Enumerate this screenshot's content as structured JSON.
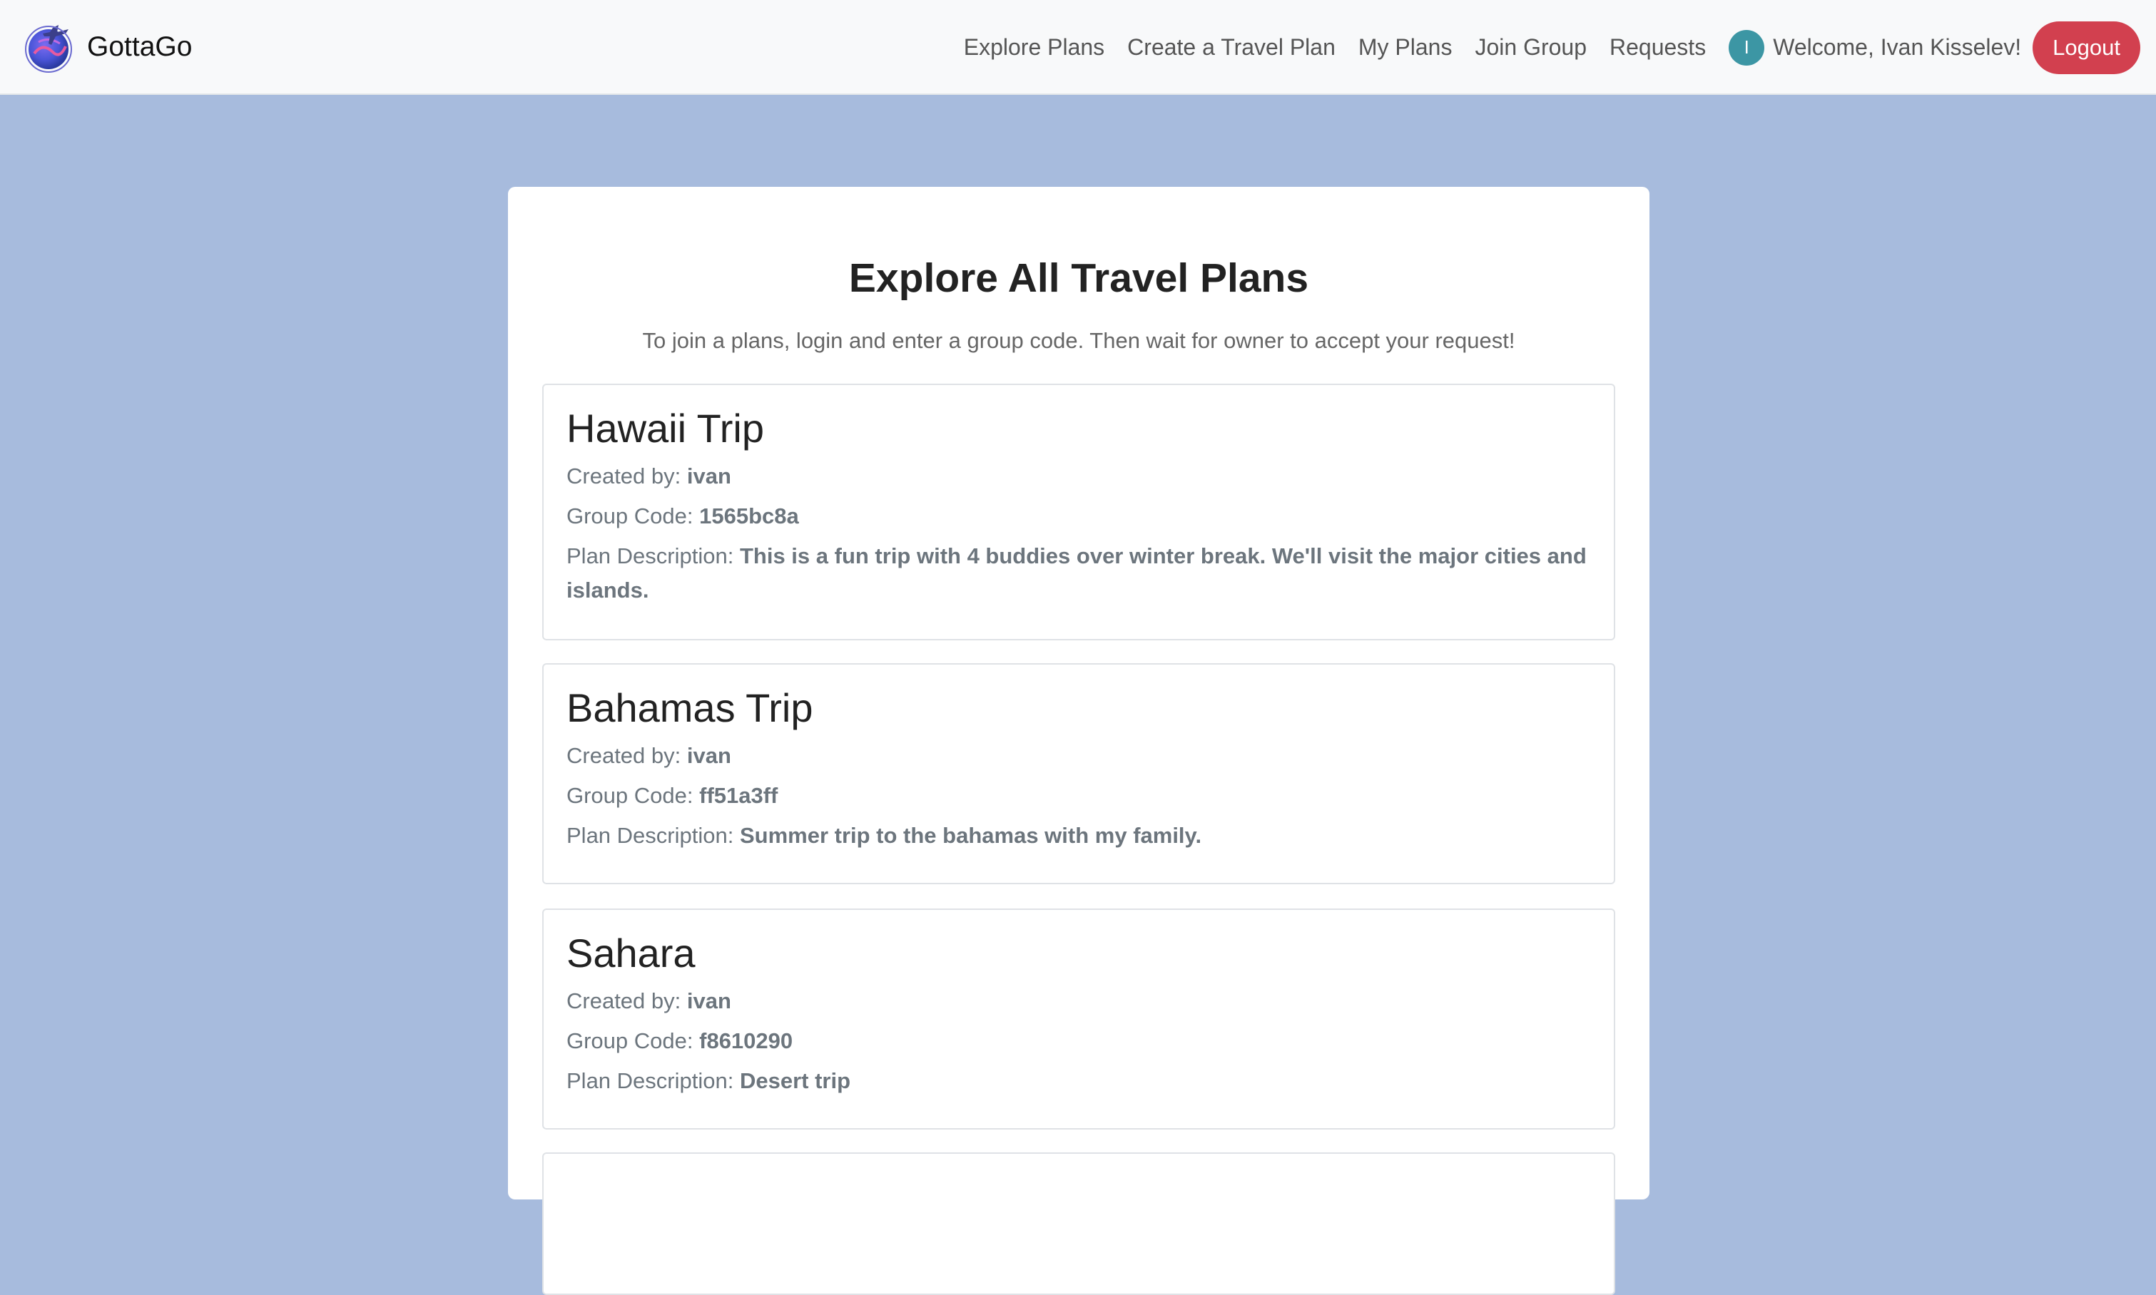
{
  "brand": {
    "name": "GottaGo"
  },
  "nav": {
    "links": [
      "Explore Plans",
      "Create a Travel Plan",
      "My Plans",
      "Join Group",
      "Requests"
    ],
    "avatar_initial": "I",
    "welcome": "Welcome, Ivan Kisselev!",
    "logout": "Logout"
  },
  "page": {
    "title": "Explore All Travel Plans",
    "subtitle": "To join a plans, login and enter a group code. Then wait for owner to accept your request!"
  },
  "labels": {
    "created_by": "Created by:",
    "group_code": "Group Code:",
    "plan_description": "Plan Description:"
  },
  "plans": [
    {
      "title": "Hawaii Trip",
      "creator": "ivan",
      "code": "1565bc8a",
      "description": "This is a fun trip with 4 buddies over winter break. We'll visit the major cities and islands."
    },
    {
      "title": "Bahamas Trip",
      "creator": "ivan",
      "code": "ff51a3ff",
      "description": "Summer trip to the bahamas with my family."
    },
    {
      "title": "Sahara",
      "creator": "ivan",
      "code": "f8610290",
      "description": "Desert trip"
    }
  ],
  "colors": {
    "background": "#a7bbdd",
    "navbar": "#f8f9fa",
    "logout": "#d2404f",
    "avatar": "#3c96a4"
  }
}
